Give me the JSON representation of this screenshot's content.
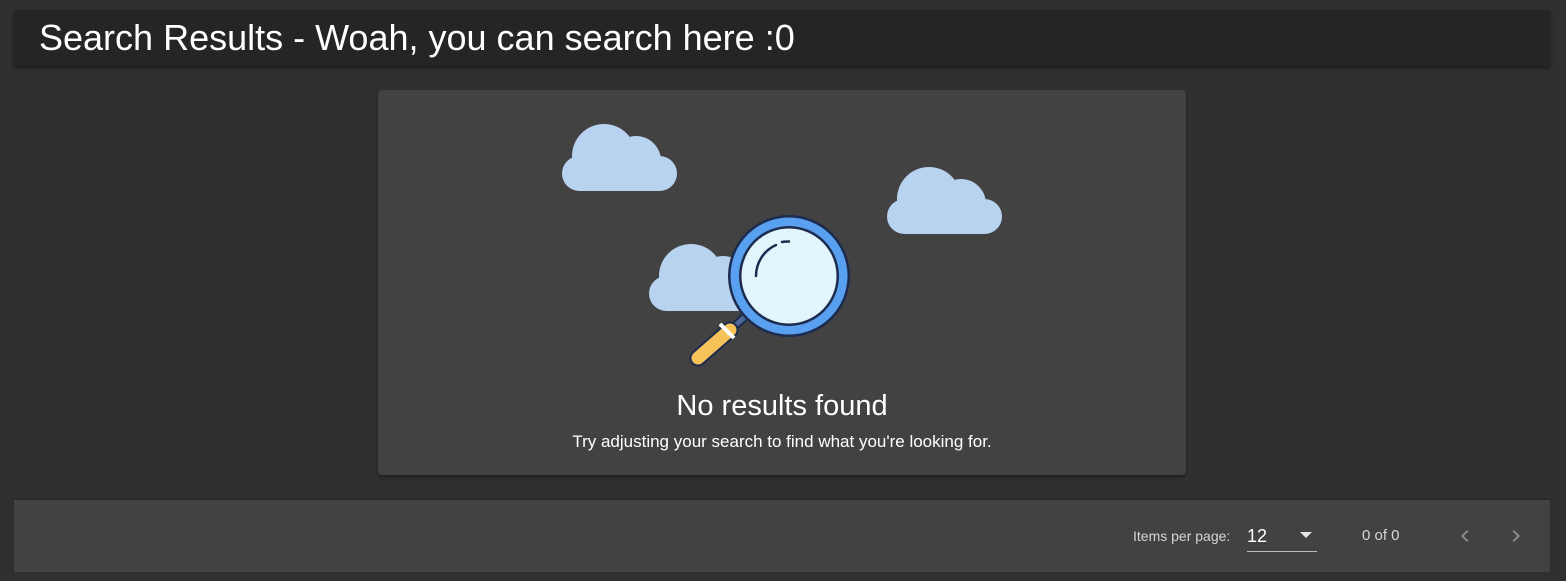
{
  "header": {
    "title": "Search Results - Woah, you can search here :0"
  },
  "empty_state": {
    "illustration": "magnifying-glass-with-clouds",
    "title": "No results found",
    "subtitle": "Try adjusting your search to find what you're looking for."
  },
  "paginator": {
    "items_per_page_label": "Items per page:",
    "items_per_page_value": "12",
    "range_label": "0 of 0",
    "prev_icon": "chevron-left-icon",
    "next_icon": "chevron-right-icon"
  },
  "colors": {
    "background": "#303030",
    "header_background": "#252525",
    "card_background": "#424242",
    "cloud": "#b8d3f0",
    "lens_ring": "#5aa0f0",
    "lens_glass": "#e0f6fc",
    "handle": "#f6c25a"
  }
}
